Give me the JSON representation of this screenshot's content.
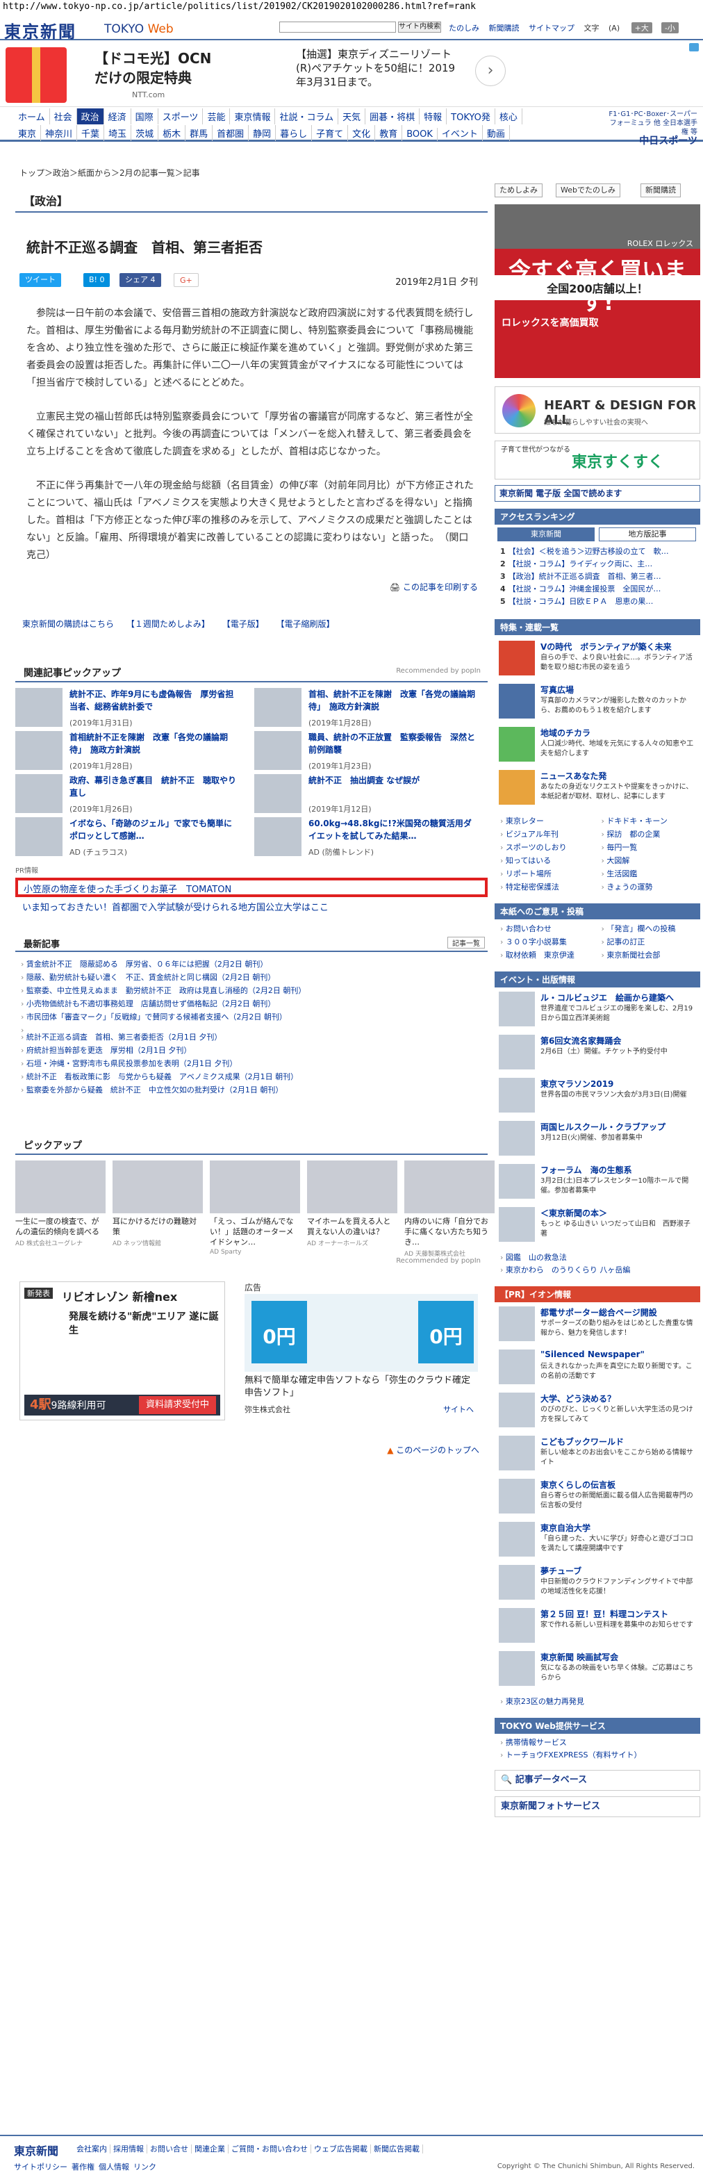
{
  "url": "http://www.tokyo-np.co.jp/article/politics/list/201902/CK2019020102000286.html?ref=rank",
  "header": {
    "logo": "東京新聞",
    "logo_sub_a": "TOKYO",
    "logo_sub_b": "Web",
    "search_button": "サイト内検索",
    "links": [
      "たのしみ",
      "新聞購読",
      "サイトマップ"
    ],
    "font_label": "文字",
    "font_size": "(A)",
    "font_larger": "+大",
    "font_smaller": "-小"
  },
  "top_ad": {
    "left_title": "【ドコモ光】OCN",
    "left_sub": "だけの限定特典",
    "left_src": "NTT.com",
    "right_text": "【抽選】東京ディズニーリゾート(R)ペアチケットを50組に！2019年3月31日まで。",
    "arrow": "›"
  },
  "nav": {
    "row1": [
      "ホーム",
      "社会",
      "政治",
      "経済",
      "国際",
      "スポーツ",
      "芸能",
      "東京情報",
      "社説・コラム",
      "天気",
      "囲碁・将棋",
      "特報",
      "TOKYO発",
      "核心"
    ],
    "row2": [
      "東京",
      "神奈川",
      "千葉",
      "埼玉",
      "茨城",
      "栃木",
      "群馬",
      "首都圏",
      "静岡",
      "暮らし",
      "子育て",
      "文化",
      "教育",
      "BOOK",
      "イベント",
      "動画"
    ],
    "active_row1": 2,
    "chunichi_small": "F1･G1･PC･Boxer･スーパーフォーミュラ 他 全日本選手権 等",
    "chunichi_big": "中日スポーツ"
  },
  "breadcrumb": "トップ＞政治＞紙面から＞2月の記事一覧＞記事",
  "article": {
    "section": "【政治】",
    "title": "統計不正巡る調査　首相、第三者拒否",
    "share_tweet": "ツイート",
    "share_hatena": "B! 0",
    "share_fb": "シェア 4",
    "share_g": "G+",
    "date": "2019年2月1日 夕刊",
    "paragraphs": [
      "参院は一日午前の本会議で、安倍晋三首相の施政方針演説など政府四演説に対する代表質問を続行した。首相は、厚生労働省による毎月勤労統計の不正調査に関し、特別監察委員会について「事務局機能を含め、より独立性を強めた形で、さらに厳正に検証作業を進めていく」と強調。野党側が求めた第三者委員会の設置は拒否した。再集計に伴い二〇一八年の実質賃金がマイナスになる可能性については「担当省庁で検討している」と述べるにとどめた。",
      "立憲民主党の福山哲郎氏は特別監察委員会について「厚労省の審議官が同席するなど、第三者性が全く確保されていない」と批判。今後の再調査については「メンバーを総入れ替えして、第三者委員会を立ち上げることを含めて徹底した調査を求める」としたが、首相は応じなかった。",
      "不正に伴う再集計で一八年の現金給与総額（名目賃金）の伸び率（対前年同月比）が下方修正されたことについて、福山氏は「アベノミクスを実態より大きく見せようとしたと言わざるを得ない」と指摘した。首相は「下方修正となった伸び率の推移のみを示して、アベノミクスの成果だと強調したことはない」と反論。「雇用、所得環境が着実に改善していることの認識に変わりはない」と語った。　（関口克己）"
    ],
    "print_link": "この記事を印刷する",
    "links_row": [
      "東京新聞の購読はこちら",
      "【１週間ためしよみ】",
      "【電子版】",
      "【電子縮刷版】"
    ]
  },
  "pickup": {
    "title": "関連記事ピックアップ",
    "recommended": "Recommended by popIn",
    "items": [
      {
        "title": "統計不正、昨年9月にも虚偽報告　厚労省担当者、総務省統計委で",
        "date": "(2019年1月31日)"
      },
      {
        "title": "首相、統計不正を陳謝　改憲「各党の議論期待」　施政方針演説",
        "date": "(2019年1月28日)"
      },
      {
        "title": "首相統計不正を陳謝　改憲「各党の議論期待」　施政方針演説",
        "date": "(2019年1月28日)"
      },
      {
        "title": "職員、統計の不正放置　監察委報告　深然と前例踏襲",
        "date": "(2019年1月23日)"
      },
      {
        "title": "政府、幕引き急ぎ裏目　統計不正　聴取やり直し",
        "date": "(2019年1月26日)"
      },
      {
        "title": "統計不正　抽出調査 なぜ誤が",
        "date": "(2019年1月12日)"
      },
      {
        "title": "イボなら、「奇跡のジェル」で家でも簡単にポロッとして感謝…",
        "date": "AD (チュラコス)"
      },
      {
        "title": "60.0kg→48.8kgに!?米国発の糖質活用ダイエットを試してみた結果…",
        "date": "AD (防備トレンド)"
      }
    ]
  },
  "pr": {
    "label": "PR情報",
    "link1": "小笠原の物産を使った手づくりお菓子　TOMATON",
    "link2": "いま知っておきたい！首都圏で入学試験が受けられる地方国公立大学はここ"
  },
  "latest": {
    "title": "最新記事",
    "button": "記事一覧",
    "group1": [
      "賃金統計不正　隠蔽認める　厚労省、０６年には把握（2月2日 朝刊）",
      "隠蔽、勤労統計も疑い濃く　不正、賃金統計と同じ構図（2月2日 朝刊）",
      "監察委、中立性見えぬまま　勤労統計不正　政府は見直し消極的（2月2日 朝刊）",
      "小売物価統計も不適切事務処理　店舗訪問せず価格転記（2月2日 朝刊）",
      "市民団体「審査マーク」「反戦線」で賛同する候補者支援へ（2月2日 朝刊）"
    ],
    "group2": [
      "統計不正巡る調査　首相、第三者委拒否（2月1日 夕刊）",
      "府統計担当幹部を更迭　厚労相（2月1日 夕刊）",
      "石垣・沖縄・宮野湾市も県民投票参加を表明（2月1日 夕刊）",
      "統計不正　看板政策に影　与党からも疑義　アベノミクス成果（2月1日 朝刊）",
      "監察委を外部から疑義　統計不正　中立性欠如の批判受け（2月1日 朝刊）"
    ]
  },
  "pickup2": {
    "title": "ピックアップ",
    "recommended": "Recommended by popIn",
    "items": [
      {
        "text": "一生に一度の検査で、がんの遺伝的傾向を調べる",
        "ad": "AD 株式会社ユーグレナ"
      },
      {
        "text": "耳にかけるだけの難聴対策",
        "ad": "AD ネッツ情報館"
      },
      {
        "text": "「えっ、ゴムが絡んでない！」話題のオーターメイドシャン…",
        "ad": "AD Sparty"
      },
      {
        "text": "マイホームを買える人と買えない人の違いは？",
        "ad": "AD オーナーホールズ"
      },
      {
        "text": "内痔のいに痔「自分でお手に痛くない方たち知うき…",
        "ad": "AD 天藤製薬株式会社"
      }
    ]
  },
  "bigads": {
    "left_tag": "新発表",
    "left_title": "リビオレゾン 新檜nex",
    "left_sub": "発展を続ける\"新虎\"エリア 遂に誕生",
    "left_pill": "資料請求受付中",
    "left_bottom_a": "4駅",
    "left_bottom_b": "9路線利用可",
    "right_label": "広告",
    "right_z0a": "0円",
    "right_z0b": "0円",
    "right_caption": "無料で簡単な確定申告ソフトなら「弥生のクラウド確定申告ソフト」",
    "right_advertiser": "弥生株式会社",
    "right_site": "サイトへ"
  },
  "to_top": "このページのトップへ",
  "side": {
    "tabs": [
      "ためしよみ",
      "Webでたのしみ",
      "新聞購読"
    ],
    "rolex_watches": "ROLEX ロレックス",
    "rolex_main": "今すぐ高く買います!",
    "rolex_band": "全国200店舗以上！",
    "rolex_low": "ロレックスを高価買取",
    "heart_title": "HEART & DESIGN FOR ALL",
    "heart_sub": "誰もが暮らしやすい社会の実現へ",
    "suku_a": "子育て世代がつながる",
    "suku_b": "東京すくすく",
    "denshi": "東京新聞 電子版 全国で読めます",
    "ranking_title": "アクセスランキング",
    "ranking_tab1": "東京新聞",
    "ranking_tab2": "地方版記事",
    "ranking": [
      {
        "n": "1",
        "t": "【社会】＜税を追う＞辺野古移設の立て　軟…"
      },
      {
        "n": "2",
        "t": "【社説・コラム】ライディック両に、主…"
      },
      {
        "n": "3",
        "t": "【政治】統計不正巡る調査　首相、第三者…"
      },
      {
        "n": "4",
        "t": "【社説・コラム】沖縄金援投票　全国民が…"
      },
      {
        "n": "5",
        "t": "【社説・コラム】日欧ＥＰＡ　恩恵の果…"
      }
    ],
    "features_title": "特集・連載一覧",
    "features": [
      {
        "t": "Vの時代　ボランティアが築く未来",
        "d": "自らの手で、より良い社会に…。ボランティア活動を取り組む市民の姿を追う"
      },
      {
        "t": "写真広場",
        "d": "写真部のカメラマンが撮影した数々のカットから、お薦めのもう１枚を紹介します"
      },
      {
        "t": "地域のチカラ",
        "d": "人口減少時代、地域を元気にする人々の知恵や工夫を紹介します"
      },
      {
        "t": "ニュースあなた発",
        "d": "あなたの身近なリクエストや提案をきっかけに、本紙記者が取材、取材し、記事にします"
      }
    ],
    "links2": [
      "東京レター",
      "ビジュアル年刊",
      "スポーツのしおり",
      "知ってはいる",
      "リポート場所",
      "特定秘密保護法",
      "ドキドキ・キーン",
      "探訪　都の企業",
      "毎円一覧",
      "大図解",
      "生活図鑑",
      "きょうの運勢"
    ],
    "guide_title": "本紙へのご意見・投稿",
    "guide": [
      "お問い合わせ",
      "３００字小説募集",
      "取材依頼　東京伊達",
      "「発言」欄への投稿",
      "記事の訂正",
      "東京新聞社会部"
    ],
    "events_title": "イベント・出版情報",
    "events": [
      {
        "t": "ル・コルビュジエ　絵画から建築へ",
        "d": "世界遺産でコルビュジエの撮影を楽しむ、2月19日から国立西洋美術館"
      },
      {
        "t": "第6回女流名家舞踊会",
        "d": "2月6日（土）開催。チケット予約受付中"
      },
      {
        "t": "東京マラソン2019",
        "d": "世界各国の市民マラソン大会が3月3日(日)開催"
      },
      {
        "t": "両国ヒルスクール・クラブアップ",
        "d": "3月12日(火)開催、参加者募集中"
      },
      {
        "t": "フォーラム　海の生態系",
        "d": "3月2日(土)日本プレスセンター10階ホールで開催。参加者募集中"
      },
      {
        "t": "＜東京新聞の本＞",
        "d": "もっと ゆる山きい いつだって山日和　西野淑子 著"
      }
    ],
    "misc_links": [
      "図鑑　山の救急法",
      "東京かわら　のうりくらり 八ヶ岳編"
    ],
    "aeon_title": "【PR】イオン情報",
    "aeon": [
      {
        "t": "都電サポーター総合ページ開設",
        "d": "サポーターズの勤り組みをはじめとした貴重な情報から、魅力を発信します！"
      },
      {
        "t": "\"Silenced Newspaper\"",
        "d": "伝えきれなかった声を真空にた取り新聞です。この名前の活動です"
      },
      {
        "t": "大学、どう決める？",
        "d": "のびのびと、じっくりと新しい大学生活の見つけ方を探してみて"
      },
      {
        "t": "こどもブックワールド",
        "d": "新しい絵本とのお出会いをここから始める情報サイト"
      },
      {
        "t": "東京くらしの伝言板",
        "d": "自ら寄らせの新聞紙面に載る個人広告掲載専門の伝言板の受付"
      },
      {
        "t": "東京自治大学",
        "d": "「自ら建った、大いに学び」好奇心と遊びゴコロを満たして講座開講中です"
      },
      {
        "t": "夢チューブ",
        "d": "中日新聞のクラウドファンディングサイトで中部の地域活性化を応援！"
      },
      {
        "t": "第２５回 豆！豆！料理コンテスト",
        "d": "家で作れる新しい豆料理を募集中のお知らせです"
      },
      {
        "t": "東京新聞 映画試写会",
        "d": "気になるあの映画をいち早く体験。ご応募はこちらから"
      }
    ],
    "promo_link": "東京23区の魅力再発見",
    "tokyoweb_title": "TOKYO Web提供サービス",
    "tokyoweb_links": [
      "携帯情報サービス",
      "トーチョウFXEXPRESS（有料サイト）"
    ],
    "kiji_db": "記事データベース",
    "photo_service": "東京新聞フォトサービス"
  },
  "footer": {
    "logo": "東京新聞",
    "links": [
      "会社案内",
      "採用情報",
      "お問い合せ",
      "関連企業",
      "ご質問・お問い合わせ",
      "ウェブ広告掲載",
      "新聞広告掲載"
    ],
    "links2": [
      "サイトポリシー",
      "著作権",
      "個人情報",
      "リンク"
    ],
    "copyright": "Copyright © The Chunichi Shimbun, All Rights Reserved."
  }
}
